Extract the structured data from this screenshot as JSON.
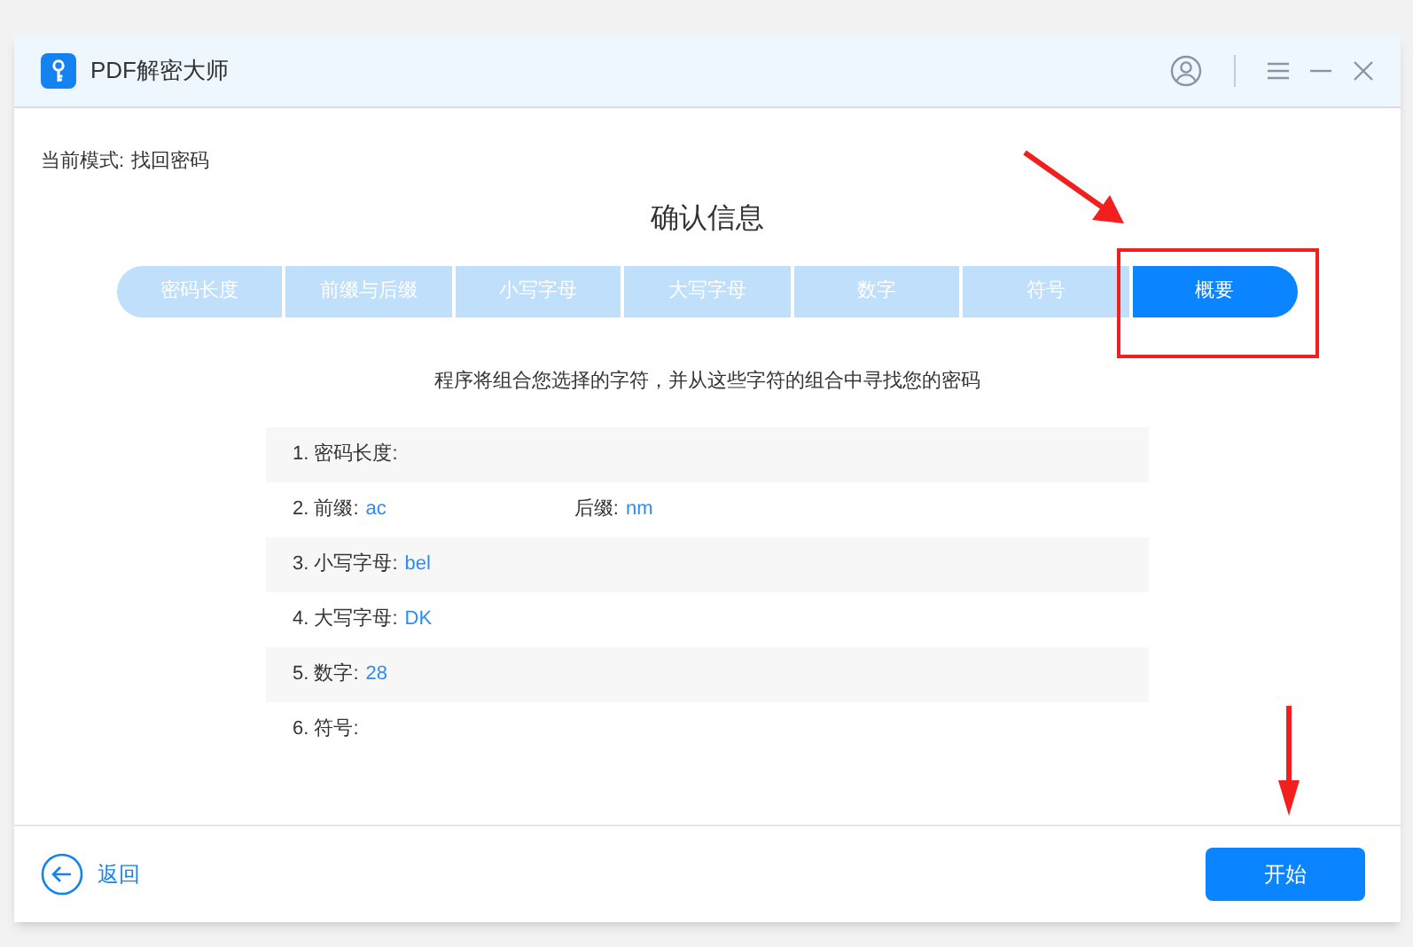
{
  "window": {
    "title": "PDF解密大师"
  },
  "mode": {
    "label": "当前模式:",
    "value": "找回密码"
  },
  "heading": "确认信息",
  "steps": [
    {
      "label": "密码长度",
      "selected": false
    },
    {
      "label": "前缀与后缀",
      "selected": false
    },
    {
      "label": "小写字母",
      "selected": false
    },
    {
      "label": "大写字母",
      "selected": false
    },
    {
      "label": "数字",
      "selected": false
    },
    {
      "label": "符号",
      "selected": false
    },
    {
      "label": "概要",
      "selected": true
    }
  ],
  "description": "程序将组合您选择的字符，并从这些字符的组合中寻找您的密码",
  "summary": [
    {
      "label": "1. 密码长度:"
    },
    {
      "label": "2. 前缀:",
      "value": "ac",
      "extra_label": "后缀:",
      "extra_value": "nm"
    },
    {
      "label": "3. 小写字母:",
      "value": "bel"
    },
    {
      "label": "4. 大写字母:",
      "value": "DK"
    },
    {
      "label": "5. 数字:",
      "value": "28"
    },
    {
      "label": "6. 符号:"
    }
  ],
  "back_button": "返回",
  "start_button": "开始"
}
